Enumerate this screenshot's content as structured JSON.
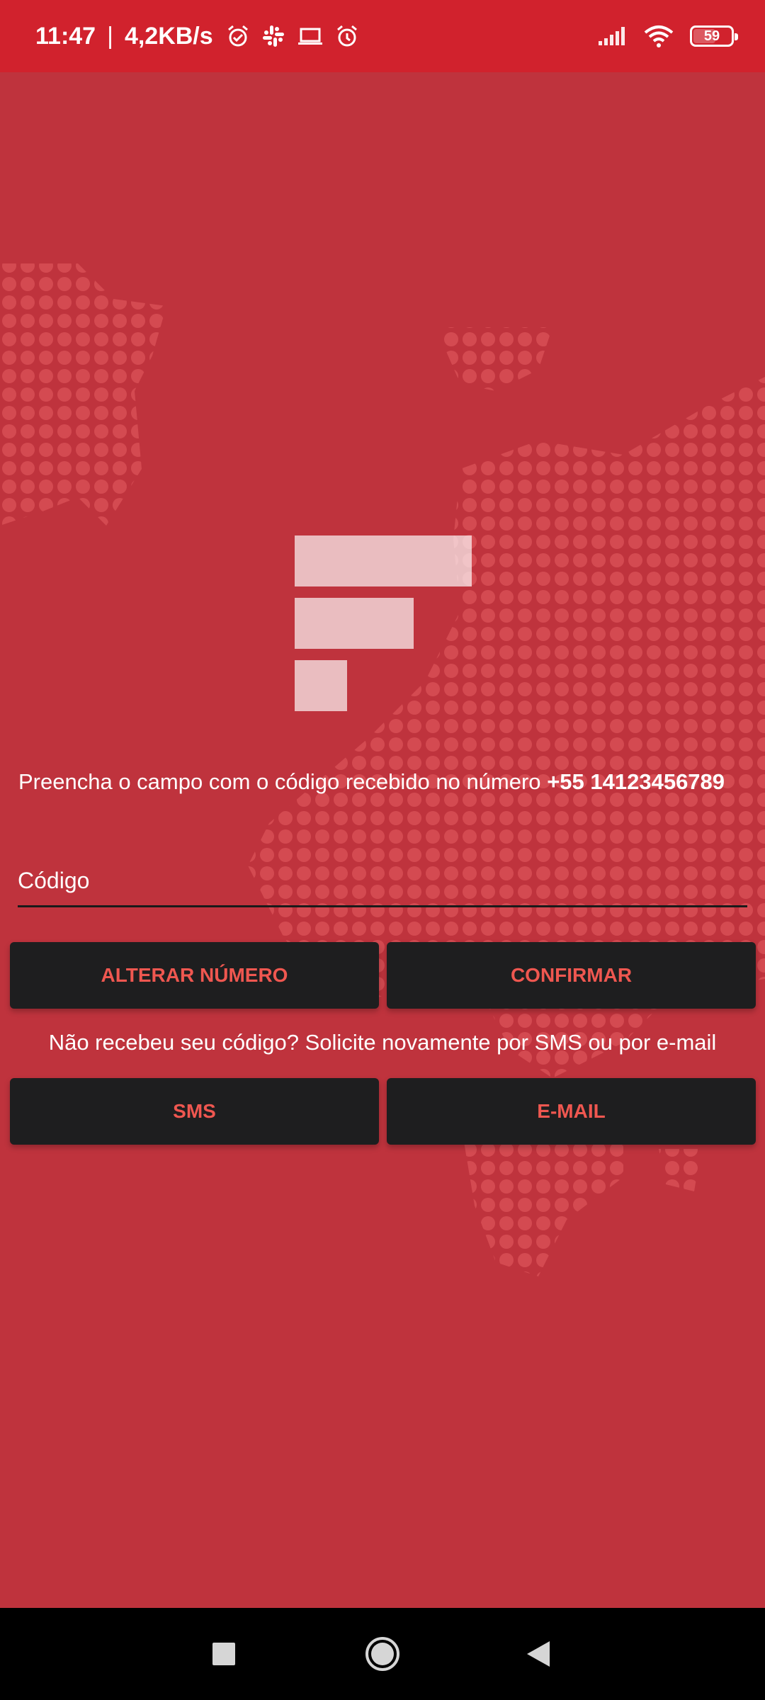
{
  "status_bar": {
    "time": "11:47",
    "separator": "|",
    "network_speed": "4,2KB/s",
    "left_icons": [
      "alarm-clock-icon",
      "slack-icon",
      "laptop-icon",
      "alarm-icon"
    ],
    "right_icons": [
      "signal-icon",
      "wifi-icon",
      "battery-icon"
    ],
    "battery_level": "59"
  },
  "colors": {
    "status_bar": "#d1222d",
    "background": "#bf333d",
    "map_dots": "#d44a51",
    "button_bg": "#1e1e1f",
    "button_text": "#ef5750",
    "logo": "#ffffff"
  },
  "logo": {
    "icon": "app-logo-icon"
  },
  "main": {
    "instruction_text": "Preencha o campo com o código recebido no número",
    "phone_number": "+55 14123456789",
    "code_field": {
      "placeholder": "Código",
      "value": ""
    },
    "change_number_label": "ALTERAR NÚMERO",
    "confirm_label": "CONFIRMAR",
    "resend_text": "Não recebeu seu código? Solicite novamente por SMS ou por e-mail",
    "sms_label": "SMS",
    "email_label": "E-MAIL"
  },
  "nav_bar": {
    "icons": [
      "recents-square-icon",
      "home-circle-icon",
      "back-triangle-icon"
    ]
  }
}
